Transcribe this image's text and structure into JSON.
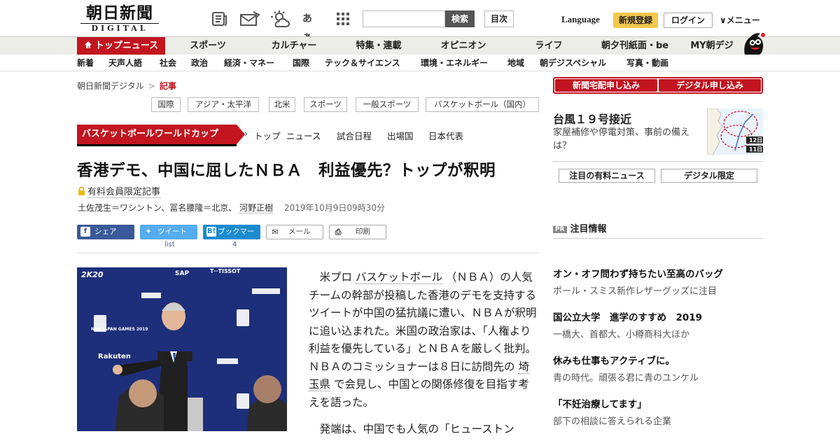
{
  "header": {
    "logo_jp": "朝日新聞",
    "logo_en": "DIGITAL",
    "search_button": "検索",
    "index_button": "目次",
    "language": "Language",
    "signup": "新規登録",
    "login": "ログイン",
    "menu": "∨メニュー",
    "icons": [
      "newspaper-icon",
      "mail-icon",
      "weather-icon",
      "font-size-icon",
      "grid-icon"
    ],
    "font_icon_text": "あぁ"
  },
  "nav_primary": [
    "トップニュース",
    "スポーツ",
    "カルチャー",
    "特集・連載",
    "オピニオン",
    "ライフ",
    "朝夕刊紙面・be",
    "MY朝デジ"
  ],
  "nav_secondary": [
    "新着",
    "天声人語",
    "社会",
    "政治",
    "経済・マネー",
    "国際",
    "テック＆サイエンス",
    "環境・エネルギー",
    "地域",
    "朝デジスペシャル",
    "写真・動画"
  ],
  "breadcrumb": {
    "home": "朝日新聞デジタル",
    "sep": ">",
    "current": "記事"
  },
  "tags": [
    "国際",
    "アジア・太平洋",
    "北米",
    "スポーツ",
    "一般スポーツ",
    "バスケットボール（国内）"
  ],
  "series": {
    "title": "バスケットボールワールドカップ",
    "links": [
      "トップ",
      "ニュース",
      "試合日程",
      "出場国",
      "日本代表"
    ]
  },
  "article": {
    "headline": "香港デモ、中国に屈したＮＢＡ　利益優先？トップが釈明",
    "paid_label": "有料会員限定記事",
    "byline_plain": "土佐茂生＝ワシントン、冨名腰隆＝北京、",
    "byline_link": "河野正樹",
    "date": "2019年10月9日09時30分",
    "share": {
      "facebook": "シェア",
      "twitter": "ツイート",
      "twitter_count": "list",
      "hatena": "ブックマーク",
      "hatena_count": "4",
      "mail": "メール",
      "print": "印刷"
    },
    "p1_a": "米プロ",
    "p1_link1": "バスケットボール",
    "p1_b": "（ＮＢＡ）の人気チームの幹部が投稿した香港のデモを支持するツイートが中国の猛抗議に遭い、ＮＢＡが釈明に追い込まれた。米国の政治家は、「人権より利益を優先している」とＮＢＡを厳しく批判。ＮＢＡのコミッショナーは８日に訪問先の",
    "p1_link2": "埼玉県",
    "p1_c": "で会見し、中国との関係修復を目指す考えを語った。",
    "p2": "発端は、中国でも人気の「ヒューストン"
  },
  "photo": {
    "logos": [
      "2K20",
      "SAP",
      "T··TISSOT",
      "Rakuten",
      "NBA JAPAN GAMES 2019"
    ]
  },
  "sidebar": {
    "delivery_button": "新聞宅配申し込み",
    "digital_button": "デジタル申し込み",
    "typhoon_title": "台風１９号接近",
    "typhoon_sub": "家屋補修や停電対策、事前の備えは？",
    "typhoon_map_labels": [
      "12日",
      "11日"
    ],
    "tab_paid": "注目の有料ニュース",
    "tab_digital": "デジタル限定",
    "pr_badge": "PR",
    "pr_title": "注目情報",
    "ads": [
      {
        "title": "オン・オフ問わず持ちたい至高のバッグ",
        "sub": "ポール・スミス新作レザーグッズに注目"
      },
      {
        "title": "国公立大学　進学のすすめ　2019",
        "sub": "一橋大、首都大、小樽商科大ほか"
      },
      {
        "title": "休みも仕事もアクティブに。",
        "sub": "青の時代。頑張る君に青のユンケル"
      },
      {
        "title": "「不妊治療してます」",
        "sub": "部下の相談に答えられる企業"
      }
    ]
  },
  "colors": {
    "brand_red": "#c2151f",
    "signup_yellow": "#f2c94c"
  }
}
